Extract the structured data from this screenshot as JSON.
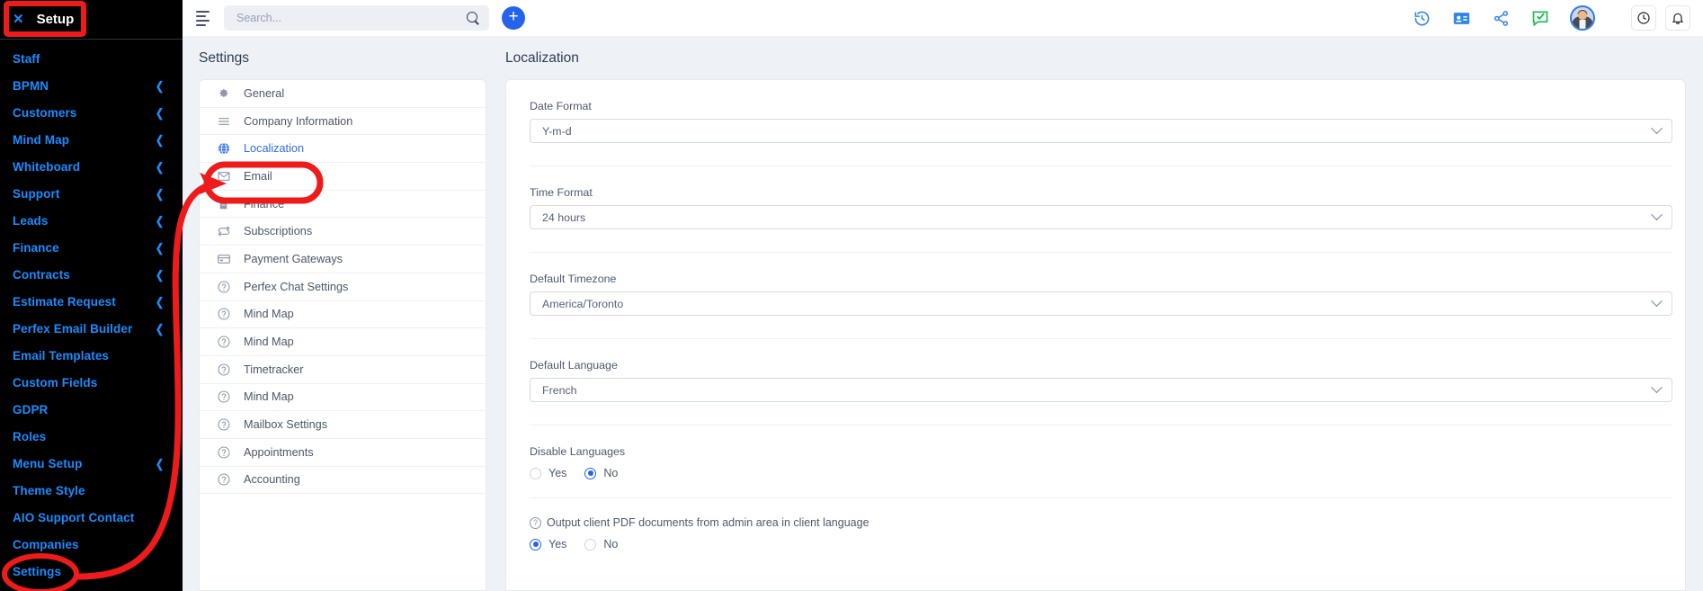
{
  "sidebar": {
    "header": {
      "close_icon": "close-icon",
      "title": "Setup"
    },
    "items": [
      {
        "label": "Staff",
        "chevron": false
      },
      {
        "label": "BPMN",
        "chevron": true
      },
      {
        "label": "Customers",
        "chevron": true
      },
      {
        "label": "Mind Map",
        "chevron": true
      },
      {
        "label": "Whiteboard",
        "chevron": true
      },
      {
        "label": "Support",
        "chevron": true
      },
      {
        "label": "Leads",
        "chevron": true
      },
      {
        "label": "Finance",
        "chevron": true
      },
      {
        "label": "Contracts",
        "chevron": true
      },
      {
        "label": "Estimate Request",
        "chevron": true
      },
      {
        "label": "Perfex Email Builder",
        "chevron": true
      },
      {
        "label": "Email Templates",
        "chevron": false
      },
      {
        "label": "Custom Fields",
        "chevron": false
      },
      {
        "label": "GDPR",
        "chevron": false
      },
      {
        "label": "Roles",
        "chevron": false
      },
      {
        "label": "Menu Setup",
        "chevron": true
      },
      {
        "label": "Theme Style",
        "chevron": false
      },
      {
        "label": "AIO Support Contact",
        "chevron": false
      },
      {
        "label": "Companies",
        "chevron": false
      },
      {
        "label": "Settings",
        "chevron": false
      }
    ],
    "chevron_glyph": "❮"
  },
  "topbar": {
    "menu_icon": "hamburger-menu-icon",
    "search": {
      "value": "",
      "placeholder": "Search...",
      "icon": "search-icon"
    },
    "add_button": {
      "label": "+",
      "icon": "plus-icon"
    },
    "icons": [
      "history-icon",
      "contact-card-icon",
      "share-icon",
      "chat-check-icon"
    ],
    "avatar": "user-avatar",
    "right_icons": [
      "clock-icon",
      "bell-icon"
    ]
  },
  "settings_panel": {
    "title": "Settings",
    "items": [
      {
        "label": "General",
        "icon": "gear-icon",
        "active": false
      },
      {
        "label": "Company Information",
        "icon": "lines-icon",
        "active": false
      },
      {
        "label": "Localization",
        "icon": "globe-icon",
        "active": true
      },
      {
        "label": "Email",
        "icon": "envelope-icon",
        "active": false
      },
      {
        "label": "Finance",
        "icon": "receipt-icon",
        "active": false
      },
      {
        "label": "Subscriptions",
        "icon": "refresh-icon",
        "active": false
      },
      {
        "label": "Payment Gateways",
        "icon": "credit-card-icon",
        "active": false
      },
      {
        "label": "Perfex Chat Settings",
        "icon": "question-circle-icon",
        "active": false
      },
      {
        "label": "Mind Map",
        "icon": "question-circle-icon",
        "active": false
      },
      {
        "label": "Mind Map",
        "icon": "question-circle-icon",
        "active": false
      },
      {
        "label": "Timetracker",
        "icon": "question-circle-icon",
        "active": false
      },
      {
        "label": "Mind Map",
        "icon": "question-circle-icon",
        "active": false
      },
      {
        "label": "Mailbox Settings",
        "icon": "question-circle-icon",
        "active": false
      },
      {
        "label": "Appointments",
        "icon": "question-circle-icon",
        "active": false
      },
      {
        "label": "Accounting",
        "icon": "question-circle-icon",
        "active": false
      }
    ]
  },
  "localization": {
    "title": "Localization",
    "date_format": {
      "label": "Date Format",
      "value": "Y-m-d"
    },
    "time_format": {
      "label": "Time Format",
      "value": "24 hours"
    },
    "default_timezone": {
      "label": "Default Timezone",
      "value": "America/Toronto"
    },
    "default_language": {
      "label": "Default Language",
      "value": "French"
    },
    "disable_languages": {
      "label": "Disable Languages",
      "yes_label": "Yes",
      "no_label": "No",
      "selected": "No"
    },
    "output_pdf": {
      "label": "Output client PDF documents from admin area in client language",
      "help_icon": "question-circle-icon",
      "yes_label": "Yes",
      "no_label": "No",
      "selected": "Yes"
    }
  },
  "annotations": {
    "highlight_color": "#ef1b1b",
    "setup_box": "rectangle-highlight-setup",
    "settings_box": "oval-highlight-settings",
    "localization_box": "oval-highlight-localization",
    "arrow": "curved-arrow-settings-to-localization"
  },
  "colors": {
    "sidebar_bg": "#000000",
    "sidebar_text": "#1a8cff",
    "accent_blue": "#2563eb",
    "page_bg": "#eef2f7",
    "annotation_red": "#ef1b1b"
  }
}
